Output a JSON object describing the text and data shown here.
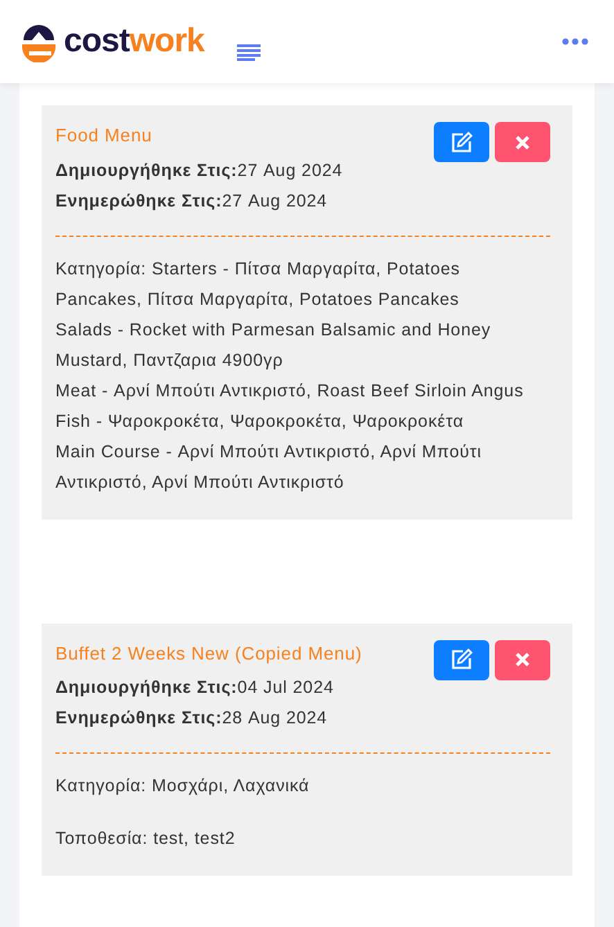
{
  "header": {
    "logo": [
      "cost",
      "work"
    ]
  },
  "menus": [
    {
      "title": "Food Menu",
      "created_label": "Δημιουργήθηκε Στις:",
      "created": "27 Aug 2024",
      "updated_label": "Ενημερώθηκε Στις:",
      "updated": "27 Aug 2024",
      "details": [
        "Κατηγορία: Starters - Πίτσα Μαργαρίτα, Potatoes Pancakes, Πίτσα Μαργαρίτα, Potatoes Pancakes",
        "Salads - Rocket with Parmesan Balsamic and Honey Mustard, Παντζαρια 4900γρ",
        "Meat - Αρνί Μπούτι Αντικριστό, Roast Beef Sirloin Angus",
        "Fish - Ψαροκροκέτα, Ψαροκροκέτα, Ψαροκροκέτα",
        "Main Course - Αρνί Μπούτι Αντικριστό, Αρνί Μπούτι Αντικριστό, Αρνί Μπούτι Αντικριστό"
      ]
    },
    {
      "title": "Buffet 2 Weeks New (Copied Menu)",
      "created_label": "Δημιουργήθηκε Στις:",
      "created": "04 Jul 2024",
      "updated_label": "Ενημερώθηκε Στις:",
      "updated": "28 Aug 2024",
      "details": [
        "Κατηγορία: Μοσχάρι, Λαχανικά"
      ],
      "location": "Τοποθεσία: test, test2"
    }
  ]
}
